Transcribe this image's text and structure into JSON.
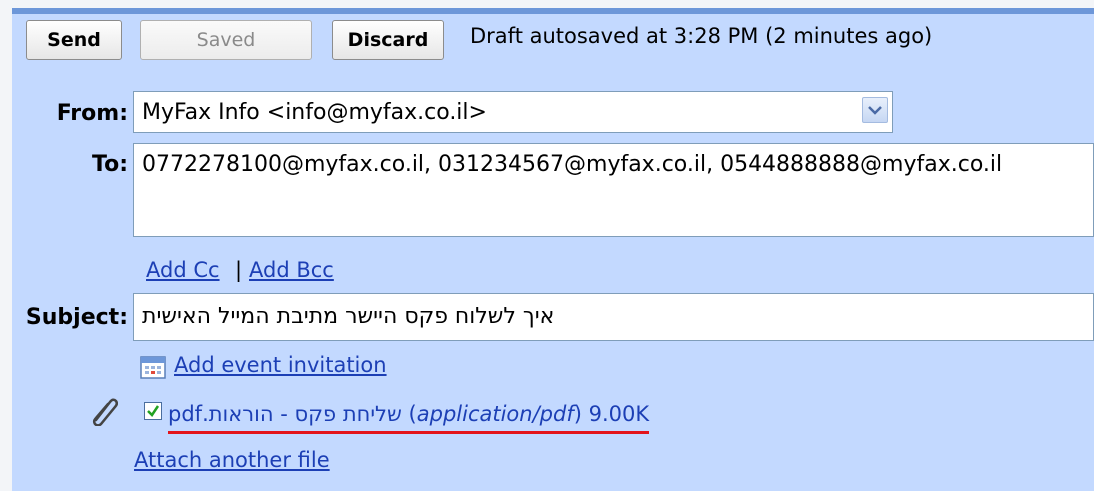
{
  "toolbar": {
    "send_label": "Send",
    "saved_label": "Saved",
    "discard_label": "Discard",
    "status": "Draft autosaved at 3:28 PM (2 minutes ago)"
  },
  "from": {
    "label": "From:",
    "value": "MyFax Info <info@myfax.co.il>"
  },
  "to": {
    "label": "To:",
    "value": "0772278100@myfax.co.il, 031234567@myfax.co.il, 0544888888@myfax.co.il"
  },
  "cc_links": {
    "add_cc": "Add Cc",
    "separator": "|",
    "add_bcc": "Add Bcc"
  },
  "subject": {
    "label": "Subject:",
    "value": "איך לשלוח פקס היישר מתיבת המייל האישית"
  },
  "event": {
    "label": "Add event invitation"
  },
  "attachment": {
    "checked": true,
    "filename": "שליחת פקס - הוראות.pdf",
    "mime": "application/pdf",
    "size": "9.00K"
  },
  "attach_another": "Attach another file",
  "colors": {
    "panel": "#c3d9ff",
    "link": "#1c3fb5",
    "highlight_underline": "#e3141b"
  }
}
